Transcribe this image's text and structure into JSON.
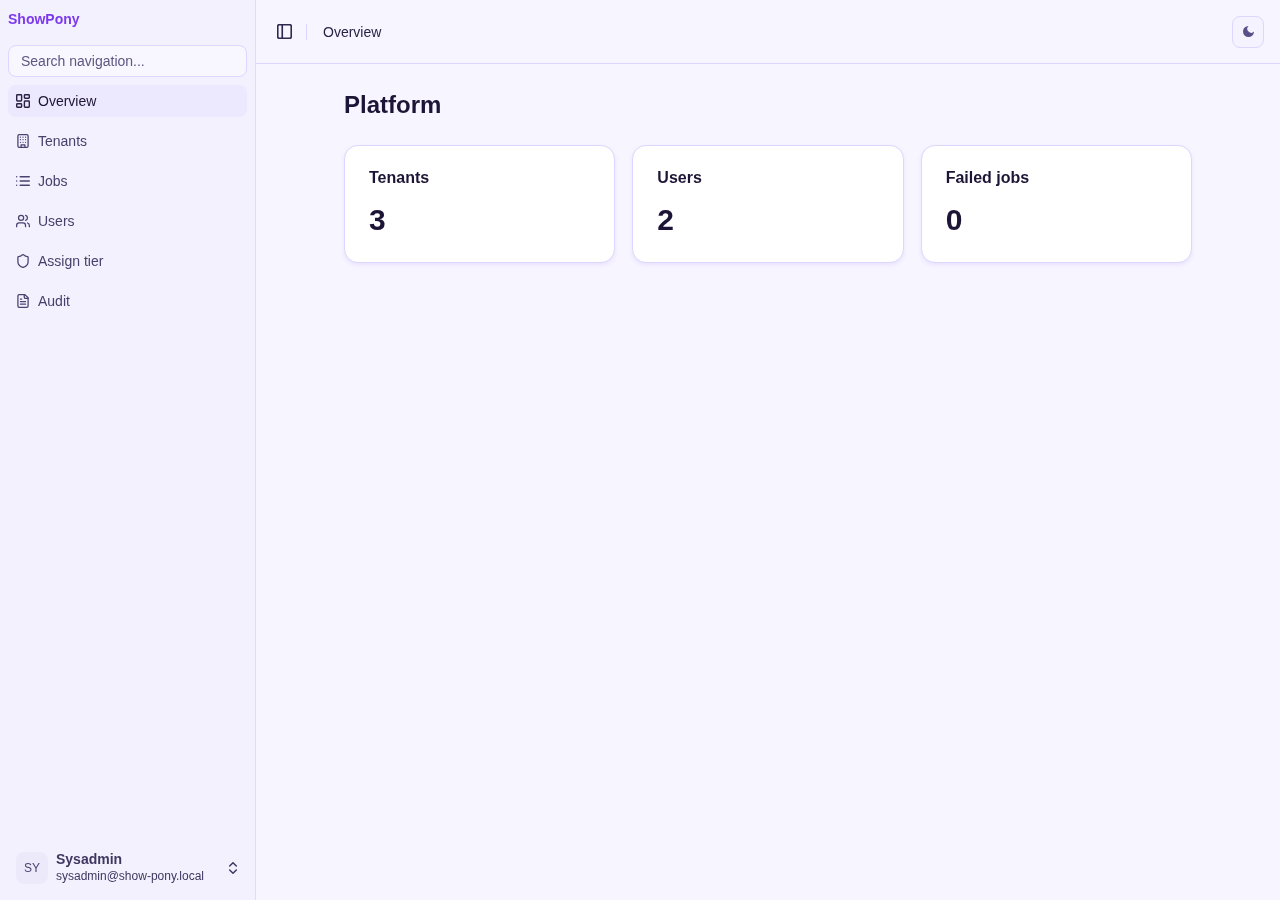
{
  "sidebar": {
    "brand": "ShowPony",
    "search": {
      "placeholder": "Search navigation..."
    },
    "items": [
      {
        "label": "Overview",
        "selected": true
      },
      {
        "label": "Tenants",
        "selected": false
      },
      {
        "label": "Jobs",
        "selected": false
      },
      {
        "label": "Users",
        "selected": false
      },
      {
        "label": "Assign tier",
        "selected": false
      },
      {
        "label": "Audit",
        "selected": false
      }
    ],
    "user": {
      "initials": "SY",
      "name": "Sysadmin",
      "email": "sysadmin@show-pony.local"
    }
  },
  "header": {
    "breadcrumb": "Overview"
  },
  "content": {
    "title": "Platform",
    "cards": [
      {
        "label": "Tenants",
        "value": "3"
      },
      {
        "label": "Users",
        "value": "2"
      },
      {
        "label": "Failed jobs",
        "value": "0"
      }
    ]
  }
}
